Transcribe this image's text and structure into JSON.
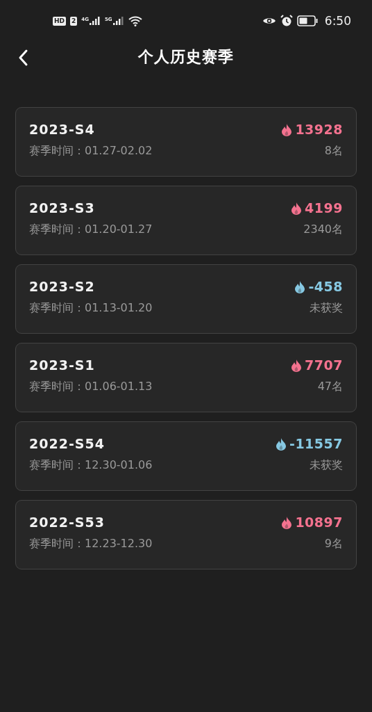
{
  "status_bar": {
    "hd": "HD",
    "sim": "2",
    "net_1": "4G",
    "net_2": "5G",
    "time": "6:50"
  },
  "header": {
    "title": "个人历史赛季"
  },
  "seasons": [
    {
      "name": "2023-S4",
      "period_label": "赛季时间：",
      "period": "01.27-02.02",
      "score": "13928",
      "color": "#f4728f",
      "rank": "8名"
    },
    {
      "name": "2023-S3",
      "period_label": "赛季时间：",
      "period": "01.20-01.27",
      "score": "4199",
      "color": "#f4728f",
      "rank": "2340名"
    },
    {
      "name": "2023-S2",
      "period_label": "赛季时间：",
      "period": "01.13-01.20",
      "score": "-458",
      "color": "#86c8e2",
      "rank": "未获奖"
    },
    {
      "name": "2023-S1",
      "period_label": "赛季时间：",
      "period": "01.06-01.13",
      "score": "7707",
      "color": "#f4728f",
      "rank": "47名"
    },
    {
      "name": "2022-S54",
      "period_label": "赛季时间：",
      "period": "12.30-01.06",
      "score": "-11557",
      "color": "#86c8e2",
      "rank": "未获奖"
    },
    {
      "name": "2022-S53",
      "period_label": "赛季时间：",
      "period": "12.23-12.30",
      "score": "10897",
      "color": "#f4728f",
      "rank": "9名"
    }
  ]
}
